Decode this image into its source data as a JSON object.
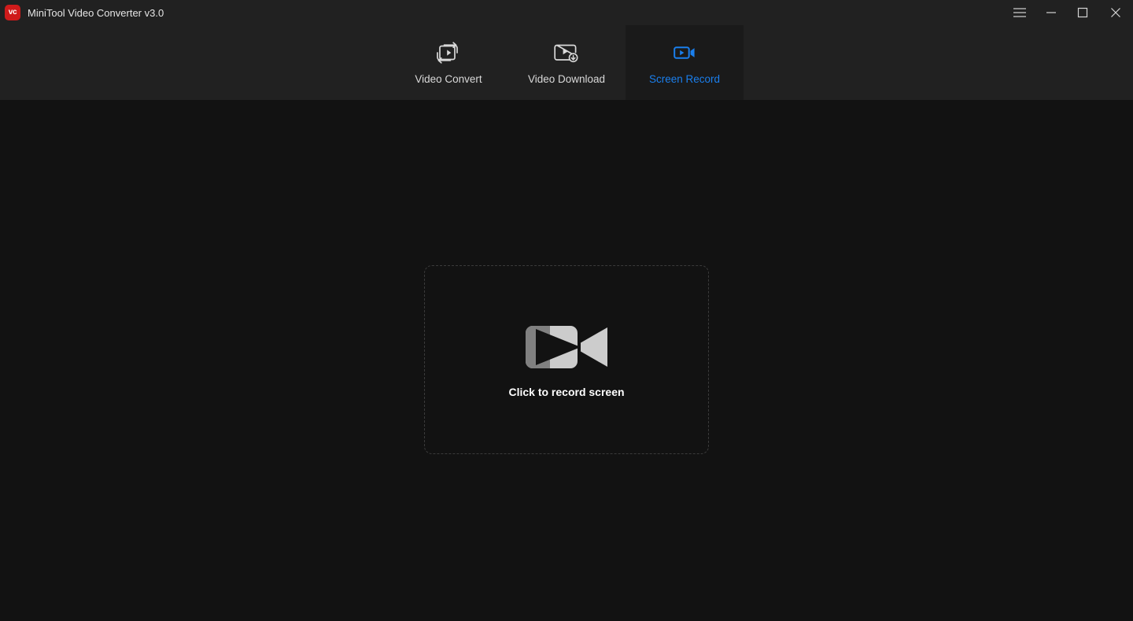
{
  "window": {
    "title": "MiniTool Video Converter v3.0",
    "logo_text": "vc",
    "logo_color": "#cf1b1b",
    "titlebar_bg": "#212121",
    "content_bg": "#121212",
    "controls": {
      "menu": "Menu",
      "minimize": "Minimize",
      "maximize": "Maximize",
      "close": "Close"
    }
  },
  "tabs": {
    "accent_color": "#1a7fed",
    "inactive_color": "#d9d9d9",
    "active_index": 2,
    "items": [
      {
        "label": "Video Convert",
        "icon": "video-convert-icon",
        "active": false
      },
      {
        "label": "Video Download",
        "icon": "video-download-icon",
        "active": false
      },
      {
        "label": "Screen Record",
        "icon": "screen-record-icon",
        "active": true
      }
    ]
  },
  "main": {
    "dropzone": {
      "label": "Click to record screen",
      "icon": "video-camera-icon",
      "border_style": "dashed",
      "border_color": "#3b3b3b",
      "icon_light_color": "#cccccc",
      "icon_dark_color": "#808080"
    }
  }
}
